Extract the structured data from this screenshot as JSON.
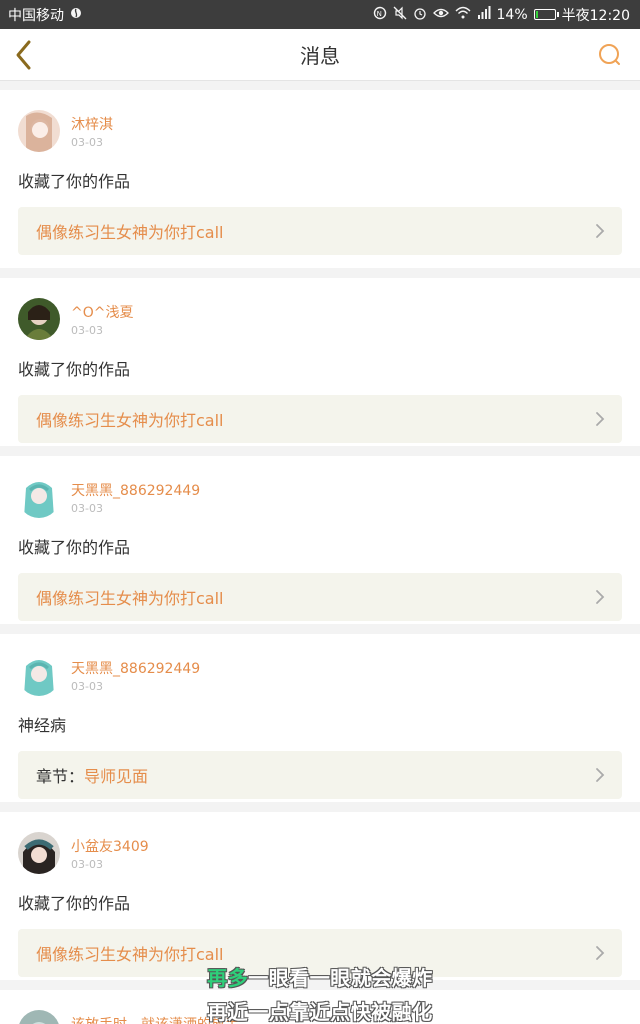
{
  "status_bar": {
    "carrier": "中国移动",
    "battery": "14%",
    "battery_level": 0.14,
    "time": "半夜12:20",
    "icons": [
      "nfc-icon",
      "mute-icon",
      "alarm-icon",
      "eye-icon",
      "wifi-icon",
      "signal-icon",
      "battery-icon"
    ]
  },
  "nav": {
    "title": "消息",
    "back_icon": "chevron-left-icon",
    "search_icon": "search-icon"
  },
  "colors": {
    "accent": "#e58d4b",
    "link_bg": "#f4f4ec",
    "status_bar_bg": "#3d3d3d"
  },
  "messages": [
    {
      "name": "沐梓淇",
      "date": "03-03",
      "text": "收藏了你的作品",
      "link": "偶像练习生女神为你打call"
    },
    {
      "name": "^O^浅夏",
      "date": "03-03",
      "text": "收藏了你的作品",
      "link": "偶像练习生女神为你打call"
    },
    {
      "name": "天黑黑_886292449",
      "date": "03-03",
      "text": "收藏了你的作品",
      "link": "偶像练习生女神为你打call"
    },
    {
      "name": "天黑黑_886292449",
      "date": "03-03",
      "text": "神经病",
      "link_prefix": "章节：",
      "link": "导师见面"
    },
    {
      "name": "小盆友3409",
      "date": "03-03",
      "text": "收藏了你的作品",
      "link": "偶像练习生女神为你打call"
    },
    {
      "name": "该放手时，就该潇洒的放手"
    }
  ],
  "subtitles": {
    "line1_highlight": "再多",
    "line1_rest": "一眼看一眼就会爆炸",
    "line2": "再近一点靠近点快被融化"
  }
}
